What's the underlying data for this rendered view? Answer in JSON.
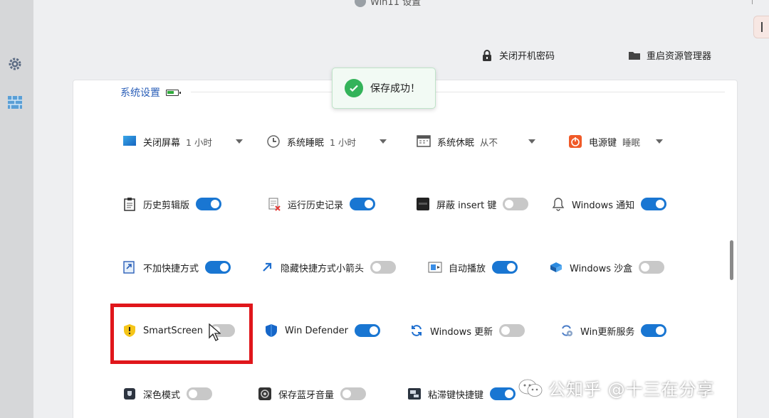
{
  "window": {
    "title": "Win11 设置"
  },
  "actions": {
    "close_password": "关闭开机密码",
    "restart_explorer": "重启资源管理器"
  },
  "section": {
    "title": "系统设置"
  },
  "toast": {
    "message": "保存成功！"
  },
  "dropdowns": [
    {
      "label": "关闭屏幕",
      "value": "1 小时",
      "icon": "monitor-icon"
    },
    {
      "label": "系统睡眠",
      "value": "1 小时",
      "icon": "clock-icon"
    },
    {
      "label": "系统休眠",
      "value": "从不",
      "icon": "hibernate-icon"
    },
    {
      "label": "电源键",
      "value": "睡眠",
      "icon": "power-icon"
    }
  ],
  "toggles": [
    {
      "label": "历史剪辑版",
      "on": true,
      "icon": "clipboard-icon"
    },
    {
      "label": "运行历史记录",
      "on": true,
      "icon": "run-history-icon"
    },
    {
      "label": "屏蔽 insert 键",
      "on": false,
      "icon": "insert-key-icon"
    },
    {
      "label": "Windows 通知",
      "on": true,
      "icon": "bell-icon"
    },
    {
      "label": "不加快捷方式",
      "on": true,
      "icon": "shortcut-icon"
    },
    {
      "label": "隐藏快捷方式小箭头",
      "on": false,
      "icon": "arrow-icon"
    },
    {
      "label": "自动播放",
      "on": true,
      "icon": "autoplay-icon"
    },
    {
      "label": "Windows 沙盒",
      "on": false,
      "icon": "sandbox-icon"
    },
    {
      "label": "SmartScreen",
      "on": false,
      "icon": "shield-warning-icon"
    },
    {
      "label": "Win Defender",
      "on": true,
      "icon": "defender-icon"
    },
    {
      "label": "Windows 更新",
      "on": false,
      "icon": "update-icon"
    },
    {
      "label": "Win更新服务",
      "on": true,
      "icon": "update-service-icon"
    },
    {
      "label": "深色模式",
      "on": false,
      "icon": "dark-mode-icon"
    },
    {
      "label": "保存蓝牙音量",
      "on": false,
      "icon": "bluetooth-volume-icon"
    },
    {
      "label": "粘滞键快捷键",
      "on": true,
      "icon": "sticky-keys-icon"
    }
  ],
  "watermark": {
    "text": "公知乎 @十三在分享"
  },
  "colors": {
    "accent": "#1976d2",
    "highlight": "#e0161b",
    "success": "#34b35a"
  }
}
